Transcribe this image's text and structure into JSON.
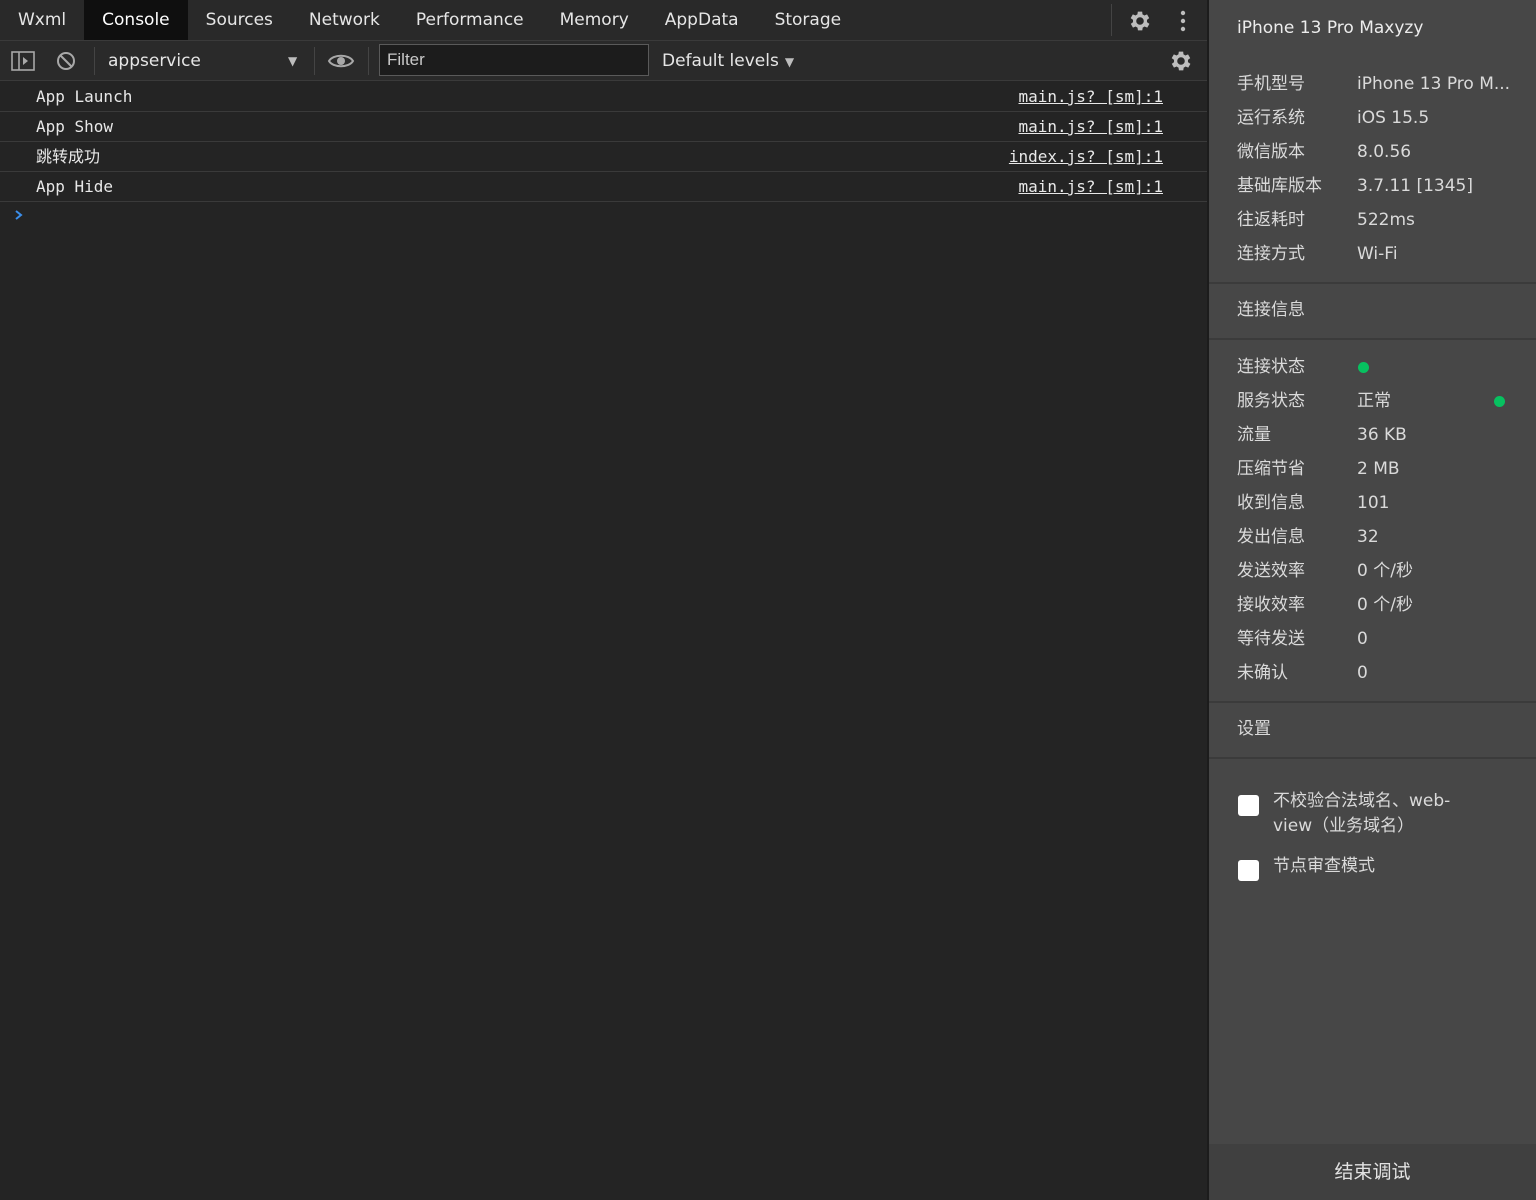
{
  "tabs": [
    {
      "label": "Wxml"
    },
    {
      "label": "Console"
    },
    {
      "label": "Sources"
    },
    {
      "label": "Network"
    },
    {
      "label": "Performance"
    },
    {
      "label": "Memory"
    },
    {
      "label": "AppData"
    },
    {
      "label": "Storage"
    }
  ],
  "active_tab": "Console",
  "toolbar": {
    "context": "appservice",
    "filter_placeholder": "Filter",
    "filter_value": "",
    "levels": "Default levels"
  },
  "console": {
    "logs": [
      {
        "message": "App Launch",
        "source": "main.js? [sm]:1"
      },
      {
        "message": "App Show",
        "source": "main.js? [sm]:1"
      },
      {
        "message": "跳转成功",
        "source": "index.js? [sm]:1"
      },
      {
        "message": "App Hide",
        "source": "main.js? [sm]:1"
      }
    ]
  },
  "device_panel": {
    "title": "iPhone 13 Pro Maxyzy",
    "info": [
      {
        "label": "手机型号",
        "value": "iPhone 13 Pro M..."
      },
      {
        "label": "运行系统",
        "value": "iOS 15.5"
      },
      {
        "label": "微信版本",
        "value": "8.0.56"
      },
      {
        "label": "基础库版本",
        "value": "3.7.11 [1345]"
      },
      {
        "label": "往返耗时",
        "value": "522ms"
      },
      {
        "label": "连接方式",
        "value": "Wi-Fi"
      }
    ],
    "connection_heading": "连接信息",
    "connection": [
      {
        "label": "连接状态",
        "value": ""
      },
      {
        "label": "服务状态",
        "value": "正常"
      },
      {
        "label": "流量",
        "value": "36 KB"
      },
      {
        "label": "压缩节省",
        "value": "2 MB"
      },
      {
        "label": "收到信息",
        "value": "101"
      },
      {
        "label": "发出信息",
        "value": "32"
      },
      {
        "label": "发送效率",
        "value": "0 个/秒"
      },
      {
        "label": "接收效率",
        "value": "0 个/秒"
      },
      {
        "label": "等待发送",
        "value": "0"
      },
      {
        "label": "未确认",
        "value": "0"
      }
    ],
    "status_color": "#07c160",
    "settings_heading": "设置",
    "settings": [
      {
        "label": "不校验合法域名、web-view（业务域名）",
        "checked": false
      },
      {
        "label": "节点审查模式",
        "checked": false
      }
    ],
    "end_button": "结束调试"
  }
}
